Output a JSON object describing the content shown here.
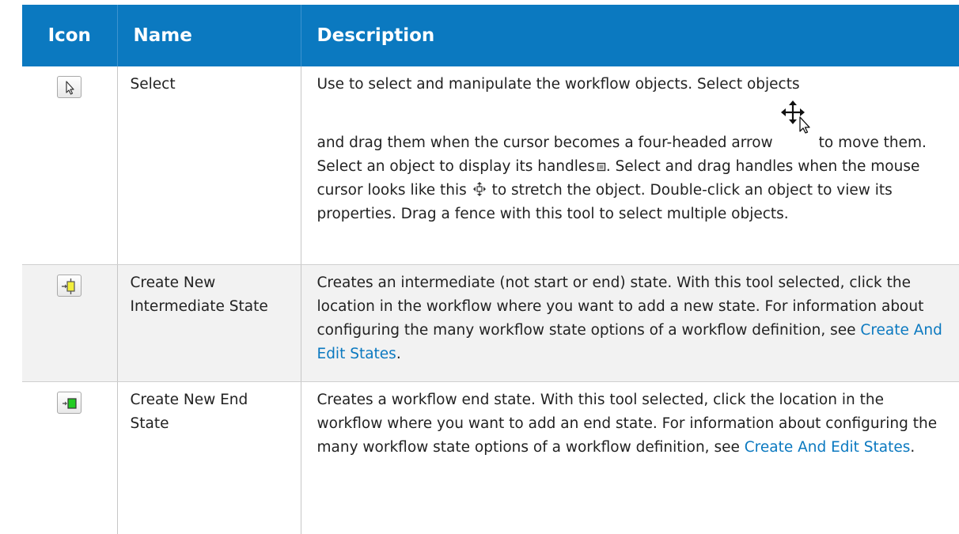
{
  "table": {
    "headers": {
      "icon": "Icon",
      "name": "Name",
      "description": "Description"
    },
    "rows": [
      {
        "icon": "select-arrow-icon",
        "name": "Select",
        "desc": {
          "p1": "Use to select and manipulate the workflow objects. Select objects",
          "p2": "and drag them when the cursor becomes a four-headed arrow",
          "p3": "to move them. Select an object to display its handles",
          "p4": ". Select and drag handles when the mouse cursor looks like this",
          "p5": "to stretch the object. Double-click an object to view its properties. Drag a fence with this tool to select multiple objects."
        }
      },
      {
        "icon": "intermediate-state-icon",
        "name": "Create New Intermediate State",
        "desc": {
          "text": "Creates an intermediate (not start or end) state. With this tool selected, click the location in the workflow where you want to add a new state. For information about configuring the many workflow state options of a workflow definition, see",
          "link": "Create And Edit States",
          "tail": "."
        }
      },
      {
        "icon": "end-state-icon",
        "name": "Create New End State",
        "desc": {
          "text": "Creates a workflow end state. With this tool selected, click the location in the workflow where you want to add an end state. For information about configuring the many workflow state options of a workflow definition, see",
          "link": "Create And Edit States",
          "tail": "."
        }
      }
    ]
  },
  "colors": {
    "header_bg": "#0b79c0",
    "link": "#0b79c0",
    "alt_row": "#f2f2f2"
  }
}
